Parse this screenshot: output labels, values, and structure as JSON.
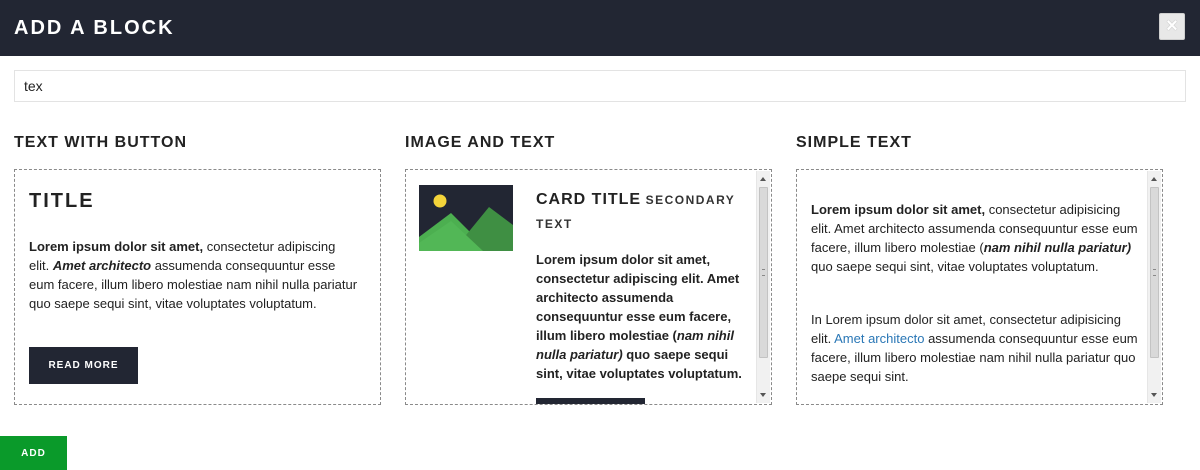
{
  "header": {
    "title": "ADD A BLOCK",
    "close_label": "×"
  },
  "search": {
    "value": "tex",
    "placeholder": ""
  },
  "blocks": [
    {
      "name": "TEXT WITH BUTTON",
      "preview": {
        "title": "TITLE",
        "para_bold": "Lorem ipsum dolor sit amet,",
        "para_text1": " consectetur adipiscing elit. ",
        "para_italic": "Amet architecto",
        "para_text2": " assumenda consequuntur esse eum facere, illum libero molestiae nam nihil nulla pariatur quo saepe sequi sint, vitae voluptates voluptatum.",
        "button_label": "READ MORE"
      }
    },
    {
      "name": "IMAGE AND TEXT",
      "preview": {
        "card_title": "CARD TITLE",
        "secondary_text": "SECONDARY TEXT",
        "para_text1": "Lorem ipsum dolor sit amet, consectetur adipiscing elit. Amet architecto assumenda consequuntur esse eum facere, illum libero molestiae (",
        "para_italic": "nam nihil nulla pariatur)",
        "para_text2": " quo saepe sequi sint, vitae voluptates voluptatum."
      }
    },
    {
      "name": "SIMPLE TEXT",
      "preview": {
        "p1_bold": "Lorem ipsum dolor sit amet,",
        "p1_text1": " consectetur adipisicing elit. Amet architecto assumenda consequuntur esse eum facere, illum libero molestiae (",
        "p1_italic": "nam nihil nulla pariatur)",
        "p1_text2": " quo saepe sequi sint, vitae voluptates voluptatum.",
        "p2_text1": "In Lorem ipsum dolor sit amet, consectetur adipisicing elit. ",
        "p2_link": "Amet architecto",
        "p2_text2": " assumenda consequuntur esse eum facere, illum libero molestiae nam nihil nulla pariatur quo saepe sequi sint."
      }
    }
  ],
  "footer": {
    "add_label": "ADD"
  },
  "colors": {
    "header_bg": "#222633",
    "add_button": "#0a9a2a",
    "link": "#2a77b6"
  },
  "icons": {
    "close": "close-icon",
    "image_placeholder": "image-icon"
  }
}
